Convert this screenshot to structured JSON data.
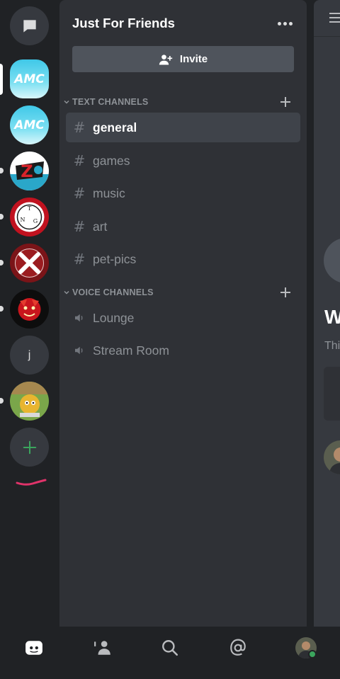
{
  "server": {
    "name": "Just For Friends",
    "invite_label": "Invite"
  },
  "rail": {
    "servers": [
      {
        "name": "direct-messages",
        "icon": "chat-bubble-icon"
      },
      {
        "name": "AMC",
        "icon_text": "AMC",
        "active": true
      },
      {
        "name": "AMC",
        "icon_text": "AMC"
      },
      {
        "name": "Z",
        "icon_text": "Z"
      },
      {
        "name": "TNG",
        "icon_text": [
          "T",
          "N",
          "G"
        ]
      },
      {
        "name": "X",
        "icon": "crossed-swords-icon"
      },
      {
        "name": "bowser",
        "icon": "bowser-icon"
      },
      {
        "name": "j",
        "icon_text": "j"
      },
      {
        "name": "dog",
        "icon": "this-is-fine-dog-icon"
      }
    ],
    "add_server_icon": "plus-icon"
  },
  "categories": [
    {
      "label": "TEXT CHANNELS",
      "channels": [
        {
          "name": "general",
          "type": "text",
          "selected": true
        },
        {
          "name": "games",
          "type": "text"
        },
        {
          "name": "music",
          "type": "text"
        },
        {
          "name": "art",
          "type": "text"
        },
        {
          "name": "pet-pics",
          "type": "text"
        }
      ]
    },
    {
      "label": "VOICE CHANNELS",
      "channels": [
        {
          "name": "Lounge",
          "type": "voice"
        },
        {
          "name": "Stream Room",
          "type": "voice"
        }
      ]
    }
  ],
  "peek": {
    "heading_fragment": "W",
    "body_fragment": "Thi"
  },
  "icons": {
    "hash": "#",
    "tabs": [
      "discord-home-icon",
      "friends-icon",
      "search-icon",
      "mentions-icon",
      "profile-avatar-icon"
    ]
  },
  "colors": {
    "rail_bg": "#202225",
    "panel_bg": "#2f3136",
    "selected_channel_bg": "#3f434a",
    "invite_bg": "#4f545c",
    "online_green": "#3ba55d",
    "add_server_green": "#3ba55d"
  }
}
